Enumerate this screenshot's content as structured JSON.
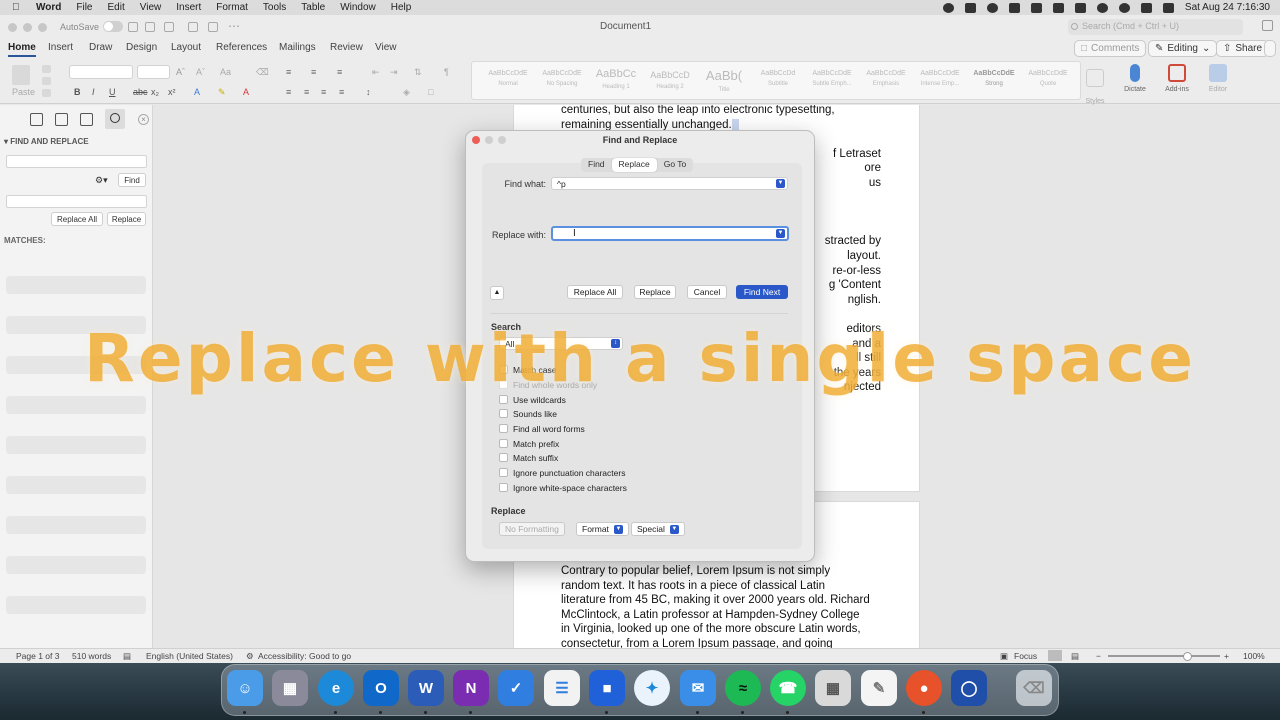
{
  "menubar": {
    "app": "Word",
    "items": [
      "File",
      "Edit",
      "View",
      "Insert",
      "Format",
      "Tools",
      "Table",
      "Window",
      "Help"
    ],
    "datetime": "Sat Aug 24  7:16:30"
  },
  "window": {
    "autosave_label": "AutoSave",
    "doc_title": "Document1",
    "search_placeholder": "Search (Cmd + Ctrl + U)"
  },
  "tabs": [
    "Home",
    "Insert",
    "Draw",
    "Design",
    "Layout",
    "References",
    "Mailings",
    "Review",
    "View"
  ],
  "header_buttons": {
    "comments": "Comments",
    "editing": "Editing",
    "share": "Share"
  },
  "ribbon": {
    "paste": "Paste",
    "styles": [
      {
        "sample": "AaBbCcDdE",
        "name": "Normal"
      },
      {
        "sample": "AaBbCcDdE",
        "name": "No Spacing"
      },
      {
        "sample": "AaBbCc",
        "name": "Heading 1"
      },
      {
        "sample": "AaBbCcD",
        "name": "Heading 2"
      },
      {
        "sample": "AaBb(",
        "name": "Title"
      },
      {
        "sample": "AaBbCcDd",
        "name": "Subtitle"
      },
      {
        "sample": "AaBbCcDdE",
        "name": "Subtle Emph..."
      },
      {
        "sample": "AaBbCcDdE",
        "name": "Emphasis"
      },
      {
        "sample": "AaBbCcDdE",
        "name": "Intense Emp..."
      },
      {
        "sample": "AaBbCcDdE",
        "name": "Strong"
      },
      {
        "sample": "AaBbCcDdE",
        "name": "Quote"
      }
    ],
    "styles_pane": "Styles\nPane",
    "dictate": "Dictate",
    "addins": "Add-ins",
    "editor": "Editor"
  },
  "left_pane": {
    "heading": "FIND AND REPLACE",
    "find_btn": "Find",
    "replace_all_btn": "Replace All",
    "replace_btn": "Replace",
    "matches_label": "MATCHES:"
  },
  "document": {
    "page1_lines": [
      "centuries, but also the leap into electronic typesetting,",
      "remaining essentially unchanged.",
      "",
      "f Letraset",
      "ore",
      "us",
      "",
      "",
      "",
      "stracted by",
      " layout.",
      "re-or-less",
      "g 'Content",
      "nglish.",
      "",
      "editors",
      "and a",
      "ll still",
      "the years",
      "njected"
    ],
    "page2_lines": [
      "Contrary to popular belief, Lorem Ipsum is not simply",
      "random text. It has roots in a piece of classical Latin",
      "literature from 45 BC, making it over 2000 years old. Richard",
      "McClintock, a Latin professor at Hampden-Sydney College",
      "in Virginia, looked up one of the more obscure Latin words,",
      "consectetur, from a Lorem Ipsum passage, and going"
    ]
  },
  "dialog": {
    "title": "Find and Replace",
    "tabs": [
      "Find",
      "Replace",
      "Go To"
    ],
    "find_label": "Find what:",
    "find_value": "^p",
    "replace_label": "Replace with:",
    "replace_value": "",
    "buttons": {
      "replace_all": "Replace All",
      "replace": "Replace",
      "cancel": "Cancel",
      "find_next": "Find Next"
    },
    "search_section": "Search",
    "search_scope": "All",
    "options": [
      {
        "label": "Match case",
        "enabled": true
      },
      {
        "label": "Find whole words only",
        "enabled": false
      },
      {
        "label": "Use wildcards",
        "enabled": true
      },
      {
        "label": "Sounds like",
        "enabled": true
      },
      {
        "label": "Find all word forms",
        "enabled": true
      },
      {
        "label": "Match prefix",
        "enabled": true
      },
      {
        "label": "Match suffix",
        "enabled": true
      },
      {
        "label": "Ignore punctuation characters",
        "enabled": true
      },
      {
        "label": "Ignore white-space characters",
        "enabled": true
      }
    ],
    "replace_section": "Replace",
    "no_formatting": "No Formatting",
    "format": "Format",
    "special": "Special"
  },
  "statusbar": {
    "page": "Page 1 of 3",
    "words": "510 words",
    "language": "English (United States)",
    "accessibility": "Accessibility: Good to go",
    "focus": "Focus",
    "zoom": "100%"
  },
  "overlay_caption": "Replace with a single space",
  "colors": {
    "accent": "#2b58c8",
    "caption": "#f0a828"
  },
  "dock_apps": [
    "finder-icon",
    "launchpad-icon",
    "edge-icon",
    "outlook-icon",
    "word-icon",
    "onenote-icon",
    "todo-icon",
    "reminders-icon",
    "teams-icon",
    "safari-icon",
    "mail-icon",
    "spotify-icon",
    "whatsapp-icon",
    "calculator-icon",
    "notes-icon",
    "firefox-icon",
    "bitwarden-icon",
    "trash-icon"
  ]
}
